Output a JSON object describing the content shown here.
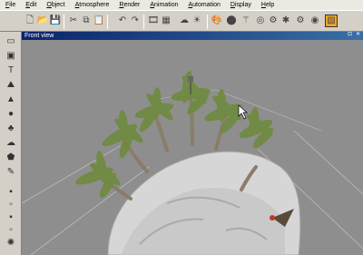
{
  "menu": [
    {
      "key": "F",
      "rest": "ile"
    },
    {
      "key": "E",
      "rest": "dit"
    },
    {
      "key": "O",
      "rest": "bject"
    },
    {
      "key": "A",
      "rest": "tmosphere"
    },
    {
      "key": "R",
      "rest": "ender"
    },
    {
      "key": "A",
      "rest": "nimation"
    },
    {
      "key": "A",
      "rest": "utomation"
    },
    {
      "key": "D",
      "rest": "isplay"
    },
    {
      "key": "H",
      "rest": "elp"
    }
  ],
  "toolbar_icons": [
    "new-document-icon",
    "open-icon",
    "save-icon",
    "cut-icon",
    "copy-icon",
    "paste-icon",
    "undo-icon",
    "redo-icon",
    "animation-icon",
    "render-icon",
    "cloud-icon",
    "lighting-icon",
    "color-palette-icon",
    "colors-icon",
    "magic-wand-icon",
    "target-icon",
    "settings-icon",
    "options-icon",
    "wireframe-icon"
  ],
  "left_icons": [
    "select-icon",
    "cube-icon",
    "text-icon",
    "terrain-icon",
    "mountain-icon",
    "sphere-icon",
    "plant-icon",
    "cloud-icon",
    "rock-icon",
    "pencil-icon",
    "object-icon",
    "object-icon-2",
    "object-icon-3",
    "object-icon-4",
    "light-icon",
    "globe-icon"
  ],
  "viewport": {
    "title": "Front view",
    "background": "#8e8e8e"
  },
  "colors": {
    "titlebar": "#0a246a",
    "palm_leaf": "#6f8a3f",
    "trunk": "#8a7d68",
    "rock": "#d0d0d0"
  }
}
